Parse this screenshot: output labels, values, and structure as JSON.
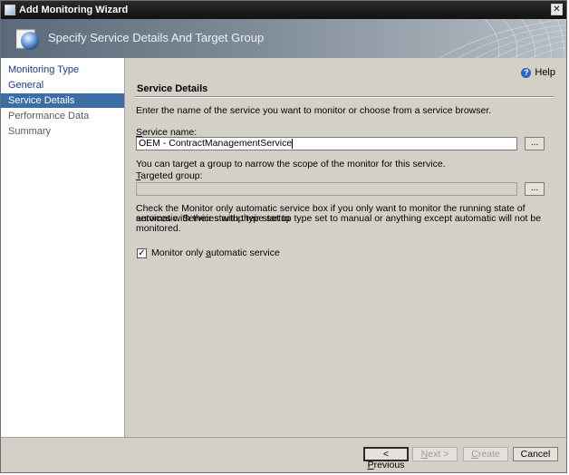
{
  "window": {
    "title": "Add Monitoring Wizard",
    "close_glyph": "✕"
  },
  "banner": {
    "title": "Specify Service Details And Target Group"
  },
  "nav": {
    "items": [
      {
        "label": "Monitoring Type",
        "state": "done"
      },
      {
        "label": "General",
        "state": "done"
      },
      {
        "label": "Service Details",
        "state": "active"
      },
      {
        "label": "Performance Data",
        "state": "pending"
      },
      {
        "label": "Summary",
        "state": "pending"
      }
    ]
  },
  "help": {
    "label": "Help",
    "icon": "help-icon"
  },
  "section": {
    "title": "Service Details",
    "intro": "Enter the name of the service you want to monitor or choose from a service browser."
  },
  "service": {
    "label_prefix": "S",
    "label_rest": "ervice name:",
    "value": "OEM - ContractManagementService",
    "browse_label": "..."
  },
  "target": {
    "hint": "You can target a group to narrow the scope of the monitor for this service.",
    "label_prefix": "T",
    "label_rest": "argeted group:",
    "value": "",
    "browse_label": "..."
  },
  "note": {
    "line1": "Check the Monitor only automatic service box if you only want to monitor the running state of services with their startup type set to",
    "line2": "automatic. Services with their startup type set to manual or anything except automatic will not be monitored."
  },
  "checkbox": {
    "label_before": "Monitor only ",
    "label_underlined": "a",
    "label_after": "utomatic service",
    "checked": true,
    "check_glyph": "✓"
  },
  "buttons": {
    "previous_prefix": "< ",
    "previous_underlined": "P",
    "previous_rest": "revious",
    "next_underlined": "N",
    "next_rest": "ext >",
    "create_underlined": "C",
    "create_rest": "reate",
    "cancel": "Cancel"
  }
}
